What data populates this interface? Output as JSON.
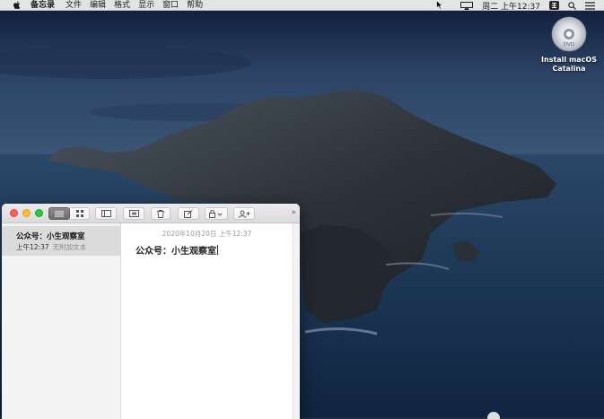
{
  "menubar": {
    "app_name": "备忘录",
    "items": [
      "文件",
      "编辑",
      "格式",
      "显示",
      "窗口",
      "帮助"
    ],
    "clock": "周二 上午12:37"
  },
  "desktop": {
    "icon_label_line1": "Install macOS",
    "icon_label_line2": "Catalina",
    "icon_badge": "DVD"
  },
  "notes": {
    "list": [
      {
        "title": "公众号：小生观察室",
        "time": "上午12:37",
        "preview": "无附加文本"
      }
    ],
    "editor": {
      "date": "2020年10月20日 上午12:37",
      "body": "公众号：小生观察室"
    },
    "toolbar_overflow": "»"
  },
  "colors": {
    "close": "#fe5f57",
    "minimize": "#febc2e",
    "maximize": "#28c840",
    "selected_note": "#dcdbdc"
  }
}
